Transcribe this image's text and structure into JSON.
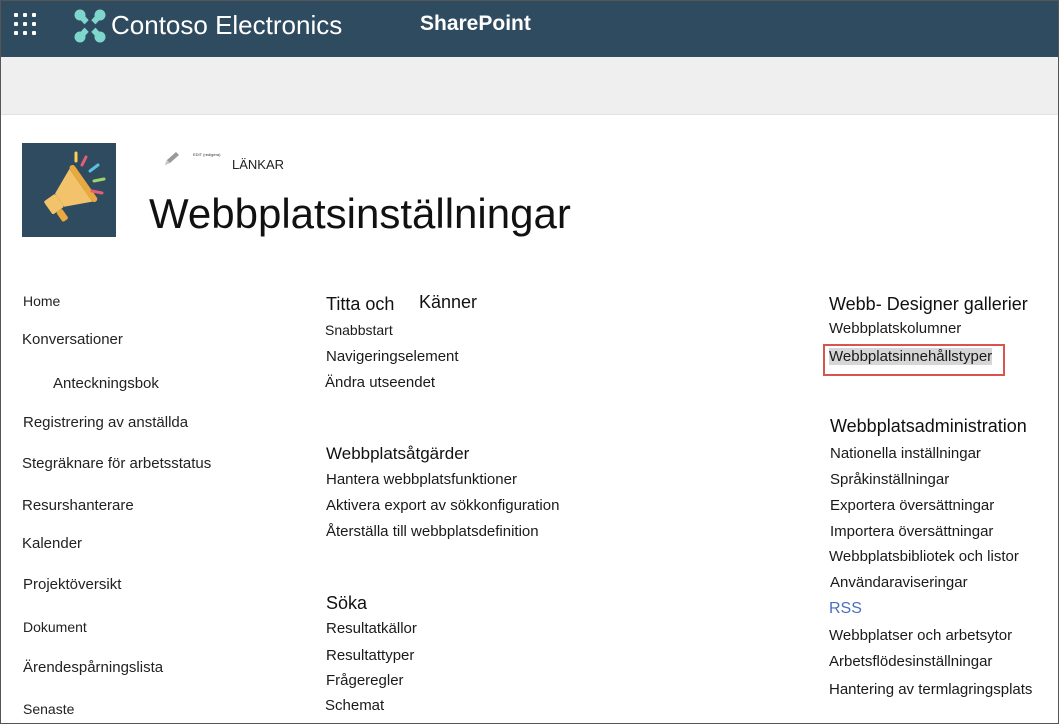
{
  "suitebar": {
    "org_name": "Contoso Electronics",
    "product": "SharePoint",
    "icons": {
      "waffle": "app-launcher-icon",
      "logo": "contoso-logo-icon"
    },
    "colors": {
      "background": "#2f4b60",
      "logo": "#7fd6cc"
    }
  },
  "header": {
    "edit_tiny": "EDIT (redigera)",
    "links_label": "LÄNKAR",
    "title": "Webbplatsinställningar",
    "icons": {
      "site_logo": "megaphone-icon",
      "edit": "pencil-icon"
    }
  },
  "nav": {
    "items": [
      "Home",
      "Konversationer",
      "Anteckningsbok",
      "Registrering av anställda",
      "Stegräknare för arbetsstatus",
      "Resurshanterare",
      "Kalender",
      "Projektöversikt",
      "Dokument",
      "Ärendespårningslista",
      "Senaste"
    ]
  },
  "sections": {
    "look_feel": {
      "heading_a": "Titta och",
      "heading_b": "Känner",
      "links": [
        "Snabbstart",
        "Navigeringselement",
        "Ändra utseendet"
      ]
    },
    "site_actions": {
      "heading": "Webbplatsåtgärder",
      "links": [
        "Hantera webbplatsfunktioner",
        "Aktivera export av sökkonfiguration",
        "Återställa till webbplatsdefinition"
      ]
    },
    "search": {
      "heading": "Söka",
      "links": [
        "Resultatkällor",
        "Resultattyper",
        "Frågeregler",
        "Schemat"
      ]
    },
    "designer": {
      "heading": "Webb- Designer gallerier",
      "links": [
        "Webbplatskolumner",
        "Webbplatsinnehållstyper"
      ]
    },
    "admin": {
      "heading": "Webbplatsadministration",
      "links": [
        "Nationella inställningar",
        "Språkinställningar",
        "Exportera översättningar",
        "Importera översättningar",
        "Webbplatsbibliotek och listor",
        "Användaraviseringar",
        "RSS",
        "Webbplatser och arbetsytor",
        "Arbetsflödesinställningar",
        "Hantering av termlagringsplats"
      ]
    },
    "highlight_color": "#d9534f"
  }
}
